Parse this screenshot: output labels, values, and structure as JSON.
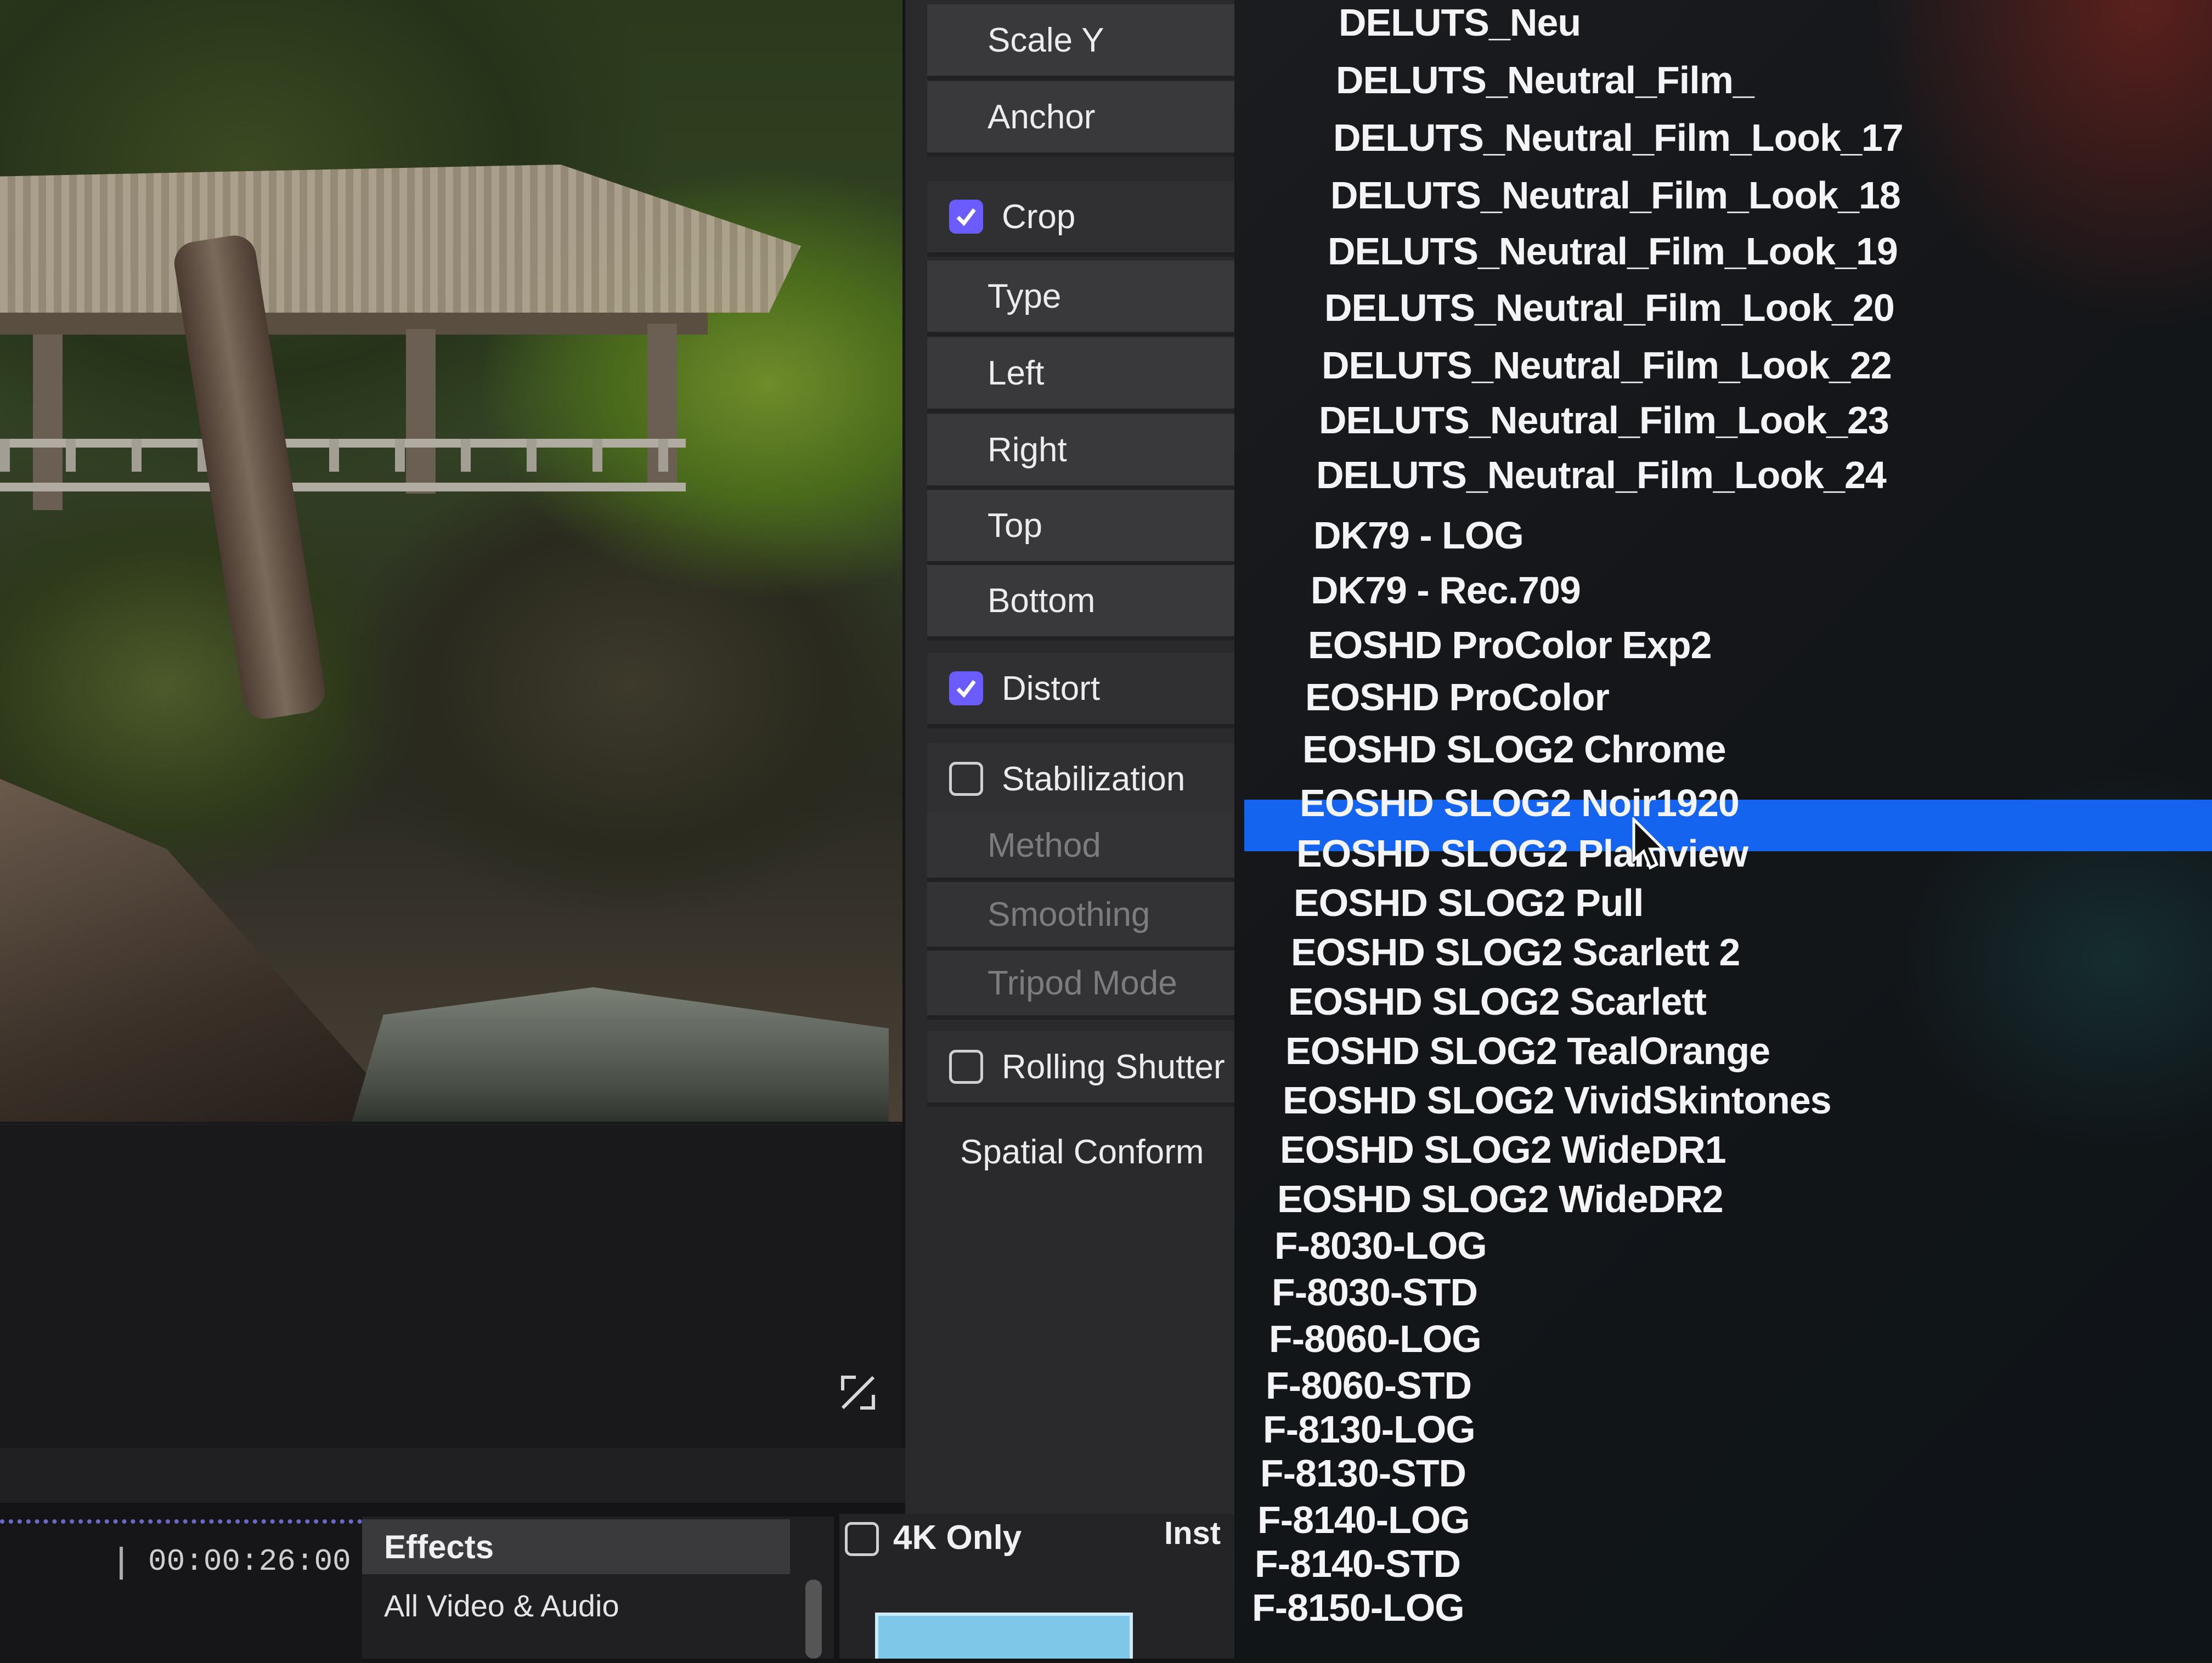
{
  "inspector": {
    "rows": {
      "scale_y": "Scale Y",
      "anchor": "Anchor",
      "crop": "Crop",
      "type": "Type",
      "left": "Left",
      "right": "Right",
      "top": "Top",
      "bottom": "Bottom",
      "distort": "Distort",
      "stabilization": "Stabilization",
      "method": "Method",
      "smoothing": "Smoothing",
      "tripod_mode": "Tripod Mode",
      "rolling_shutter": "Rolling Shutter",
      "spatial_conform": "Spatial Conform"
    },
    "checked": {
      "crop": true,
      "distort": true,
      "stabilization": false,
      "rolling_shutter": false
    }
  },
  "lut_menu": {
    "selected": "EOSHD SLOG2 Noir1920",
    "items": [
      "DELUTS_Neu",
      "DELUTS_Neutral_Film_",
      "DELUTS_Neutral_Film_Look_17",
      "DELUTS_Neutral_Film_Look_18",
      "DELUTS_Neutral_Film_Look_19",
      "DELUTS_Neutral_Film_Look_20",
      "DELUTS_Neutral_Film_Look_22",
      "DELUTS_Neutral_Film_Look_23",
      "DELUTS_Neutral_Film_Look_24",
      "DK79 - LOG",
      "DK79 - Rec.709",
      "EOSHD ProColor Exp2",
      "EOSHD ProColor",
      "EOSHD SLOG2 Chrome",
      "EOSHD SLOG2 Noir1920",
      "EOSHD SLOG2 Plainview",
      "EOSHD SLOG2 Pull",
      "EOSHD SLOG2 Scarlett 2",
      "EOSHD SLOG2 Scarlett",
      "EOSHD SLOG2 TealOrange",
      "EOSHD SLOG2 VividSkintones",
      "EOSHD SLOG2 WideDR1",
      "EOSHD SLOG2 WideDR2",
      "F-8030-LOG",
      "F-8030-STD",
      "F-8060-LOG",
      "F-8060-STD",
      "F-8130-LOG",
      "F-8130-STD",
      "F-8140-LOG",
      "F-8140-STD",
      "F-8150-LOG"
    ]
  },
  "browser": {
    "timecode": "00:00:26:00",
    "effects_header": "Effects",
    "effects_item": "All Video & Audio",
    "fourk_only": "4K Only",
    "installed": "Inst"
  },
  "colors": {
    "selection": "#1464f0",
    "checkbox_on": "#6a5cff",
    "panel": "#39393c",
    "background": "#141416"
  },
  "icons": [
    "checkmark-icon",
    "expand-icon",
    "pointer-cursor-icon"
  ]
}
